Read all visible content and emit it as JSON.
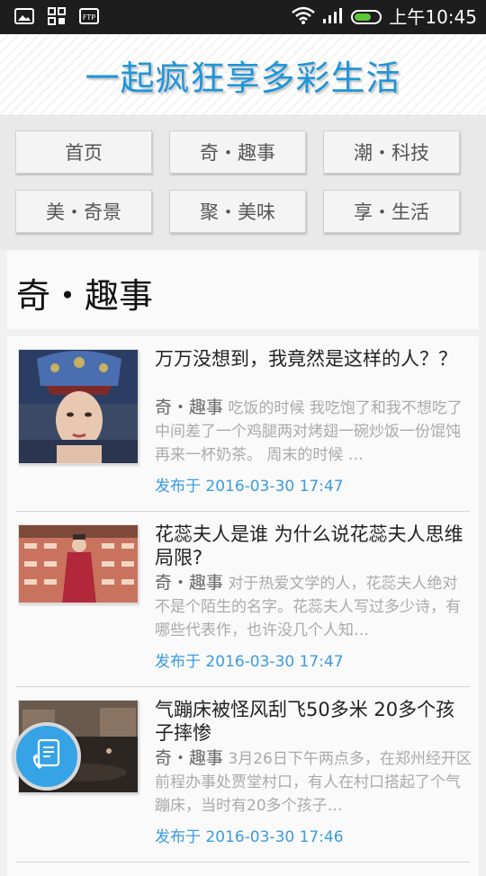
{
  "status_bar": {
    "time": "上午10:45",
    "icons": [
      "image-icon",
      "apps-icon",
      "ftp-icon",
      "wifi-icon",
      "signal-icon",
      "battery-icon"
    ],
    "ftp_label": "FTP"
  },
  "header": {
    "title": "一起疯狂享多彩生活",
    "color": "#1f95d8"
  },
  "nav": {
    "items": [
      {
        "label": "首页"
      },
      {
        "label": "奇・趣事"
      },
      {
        "label": "潮・科技"
      },
      {
        "label": "美・奇景"
      },
      {
        "label": "聚・美味"
      },
      {
        "label": "享・生活"
      }
    ]
  },
  "section": {
    "title": "奇・趣事"
  },
  "articles": [
    {
      "title": "万万没想到，我竟然是这样的人？？",
      "category": "奇・趣事",
      "summary": "吃饭的时候 我吃饱了和我不想吃了中间差了一个鸡腿两对烤翅一碗炒饭一份馄饨再来一杯奶茶。 周末的时候 …",
      "date": "发布于 2016-03-30 17:47"
    },
    {
      "title": "花蕊夫人是谁 为什么说花蕊夫人思维局限?",
      "category": "奇・趣事",
      "summary": "对于热爱文学的人，花蕊夫人绝对不是个陌生的名字。花蕊夫人写过多少诗，有哪些代表作，也许没几个人知…",
      "date": "发布于 2016-03-30 17:47"
    },
    {
      "title": "气蹦床被怪风刮飞50多米 20多个孩子摔惨",
      "category": "奇・趣事",
      "summary": "3月26日下午两点多，在郑州经开区前程办事处贾堂村口，有人在村口搭起了个气蹦床，当时有20多个孩子…",
      "date": "发布于 2016-03-30 17:46"
    }
  ],
  "accent_color": "#3a9be0",
  "fab": {
    "icon": "phone-call-icon"
  }
}
